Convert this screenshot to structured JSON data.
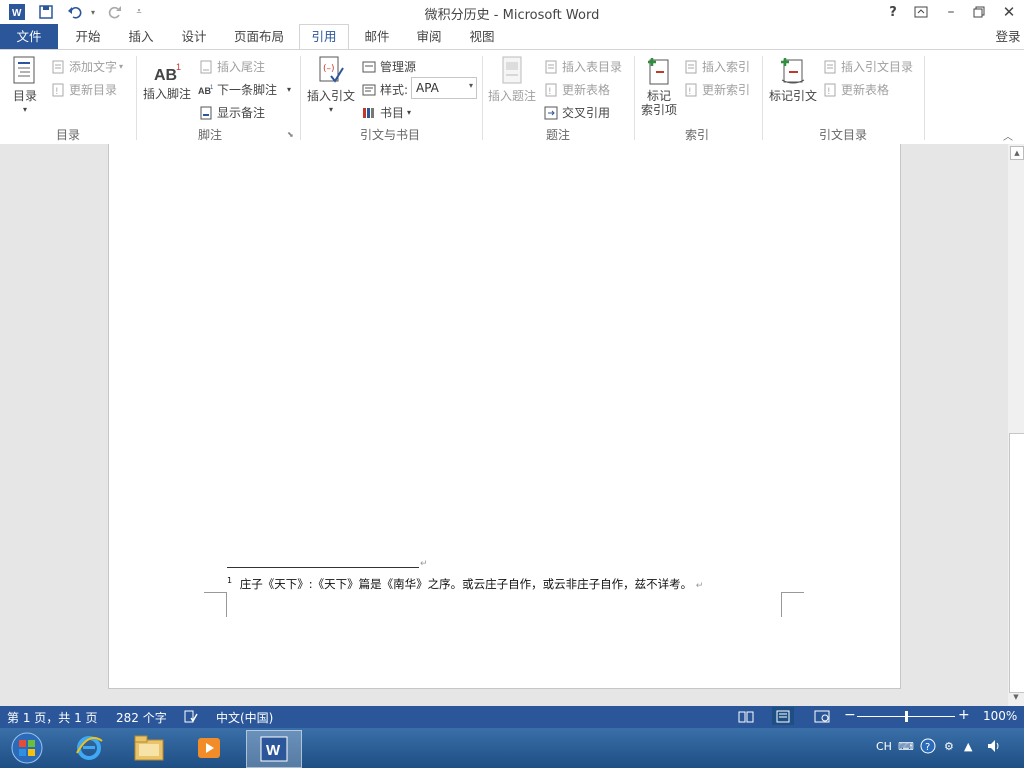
{
  "window": {
    "title": "微积分历史 - Microsoft Word",
    "help": "?",
    "login": "登录"
  },
  "tabs": [
    "文件",
    "开始",
    "插入",
    "设计",
    "页面布局",
    "引用",
    "邮件",
    "审阅",
    "视图"
  ],
  "ribbon": {
    "toc": {
      "big_label": "目录",
      "add_text": "添加文字",
      "update_toc": "更新目录",
      "group": "目录"
    },
    "footnotes": {
      "insert_footnote": "插入脚注",
      "insert_endnote": "插入尾注",
      "next_footnote": "下一条脚注",
      "show_notes": "显示备注",
      "group": "脚注"
    },
    "citations": {
      "insert_citation": "插入引文",
      "manage_sources": "管理源",
      "style_label": "样式:",
      "style_value": "APA",
      "bibliography": "书目",
      "group": "引文与书目"
    },
    "captions": {
      "insert_caption": "插入题注",
      "insert_table_of_figures": "插入表目录",
      "update_table": "更新表格",
      "cross_reference": "交叉引用",
      "group": "题注"
    },
    "index": {
      "mark_entry_line1": "标记",
      "mark_entry_line2": "索引项",
      "insert_index": "插入索引",
      "update_index": "更新索引",
      "group": "索引"
    },
    "toa": {
      "mark_citation": "标记引文",
      "insert_toa": "插入引文目录",
      "update_table": "更新表格",
      "group": "引文目录"
    }
  },
  "document": {
    "footnote_number": "1",
    "footnote_text": "庄子《天下》:《天下》篇是《南华》之序。或云庄子自作，或云非庄子自作，兹不详考。",
    "para_mark": "↵"
  },
  "statusbar": {
    "page": "第 1 页，共 1 页",
    "words": "282 个字",
    "language": "中文(中国)",
    "zoom": "100%",
    "zoom_level": 0.5
  },
  "taskbar": {
    "ime": "CH"
  },
  "colors": {
    "accent": "#2b579a",
    "taskbar": "#1e4f84"
  }
}
